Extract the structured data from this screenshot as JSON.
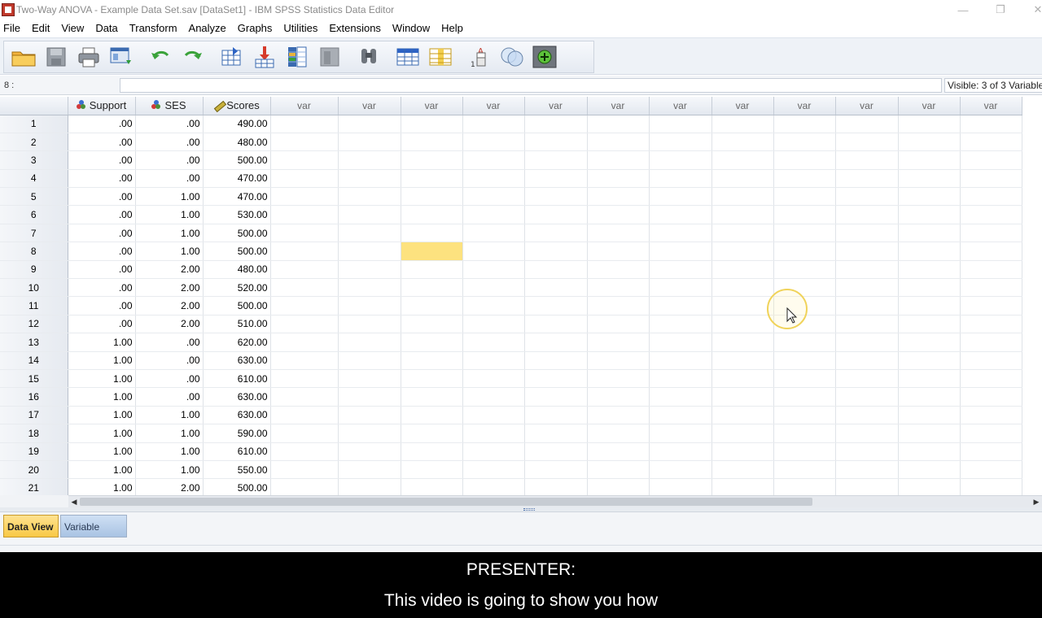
{
  "window": {
    "title": "Two-Way ANOVA - Example Data Set.sav [DataSet1] - IBM SPSS Statistics Data Editor"
  },
  "menu": [
    "File",
    "Edit",
    "View",
    "Data",
    "Transform",
    "Analyze",
    "Graphs",
    "Utilities",
    "Extensions",
    "Window",
    "Help"
  ],
  "toolbar": {
    "icons": [
      "open-folder-icon",
      "save-icon",
      "print-icon",
      "recall-dialog-icon",
      "undo-icon",
      "redo-icon",
      "goto-case-icon",
      "goto-variable-icon",
      "variables-icon",
      "run-descriptives-icon",
      "find-icon",
      "insert-cases-icon",
      "insert-variable-icon",
      "split-file-icon",
      "value-labels-icon",
      "use-sets-icon",
      "spell-check-icon"
    ]
  },
  "cell_editor": {
    "cell_id": "8 :",
    "value": "",
    "visible_text": "Visible: 3 of 3 Variables"
  },
  "grid": {
    "columns": [
      {
        "name": "Support",
        "type": "nominal"
      },
      {
        "name": "SES",
        "type": "nominal"
      },
      {
        "name": "Scores",
        "type": "scale"
      },
      {
        "name": "var"
      },
      {
        "name": "var"
      },
      {
        "name": "var"
      },
      {
        "name": "var"
      },
      {
        "name": "var"
      },
      {
        "name": "var"
      },
      {
        "name": "var"
      },
      {
        "name": "var"
      },
      {
        "name": "var"
      },
      {
        "name": "var"
      },
      {
        "name": "var"
      },
      {
        "name": "var"
      }
    ],
    "rows": [
      {
        "id": "1",
        "support": ".00",
        "ses": ".00",
        "scores": "490.00"
      },
      {
        "id": "2",
        "support": ".00",
        "ses": ".00",
        "scores": "480.00"
      },
      {
        "id": "3",
        "support": ".00",
        "ses": ".00",
        "scores": "500.00"
      },
      {
        "id": "4",
        "support": ".00",
        "ses": ".00",
        "scores": "470.00"
      },
      {
        "id": "5",
        "support": ".00",
        "ses": "1.00",
        "scores": "470.00"
      },
      {
        "id": "6",
        "support": ".00",
        "ses": "1.00",
        "scores": "530.00"
      },
      {
        "id": "7",
        "support": ".00",
        "ses": "1.00",
        "scores": "500.00"
      },
      {
        "id": "8",
        "support": ".00",
        "ses": "1.00",
        "scores": "500.00"
      },
      {
        "id": "9",
        "support": ".00",
        "ses": "2.00",
        "scores": "480.00"
      },
      {
        "id": "10",
        "support": ".00",
        "ses": "2.00",
        "scores": "520.00"
      },
      {
        "id": "11",
        "support": ".00",
        "ses": "2.00",
        "scores": "500.00"
      },
      {
        "id": "12",
        "support": ".00",
        "ses": "2.00",
        "scores": "510.00"
      },
      {
        "id": "13",
        "support": "1.00",
        "ses": ".00",
        "scores": "620.00"
      },
      {
        "id": "14",
        "support": "1.00",
        "ses": ".00",
        "scores": "630.00"
      },
      {
        "id": "15",
        "support": "1.00",
        "ses": ".00",
        "scores": "610.00"
      },
      {
        "id": "16",
        "support": "1.00",
        "ses": ".00",
        "scores": "630.00"
      },
      {
        "id": "17",
        "support": "1.00",
        "ses": "1.00",
        "scores": "630.00"
      },
      {
        "id": "18",
        "support": "1.00",
        "ses": "1.00",
        "scores": "590.00"
      },
      {
        "id": "19",
        "support": "1.00",
        "ses": "1.00",
        "scores": "610.00"
      },
      {
        "id": "20",
        "support": "1.00",
        "ses": "1.00",
        "scores": "550.00"
      },
      {
        "id": "21",
        "support": "1.00",
        "ses": "2.00",
        "scores": "500.00"
      }
    ],
    "selected_row": 8,
    "selected_col": 6
  },
  "tabs": {
    "data_view": "Data View",
    "variable_view": "Variable View"
  },
  "caption": {
    "line1": "PRESENTER:",
    "line2": "This video is going to show you how"
  },
  "colors": {
    "selected_cell": "#fde27f",
    "active_tab": "#f8c945",
    "inactive_tab": "#a9c3e3"
  }
}
